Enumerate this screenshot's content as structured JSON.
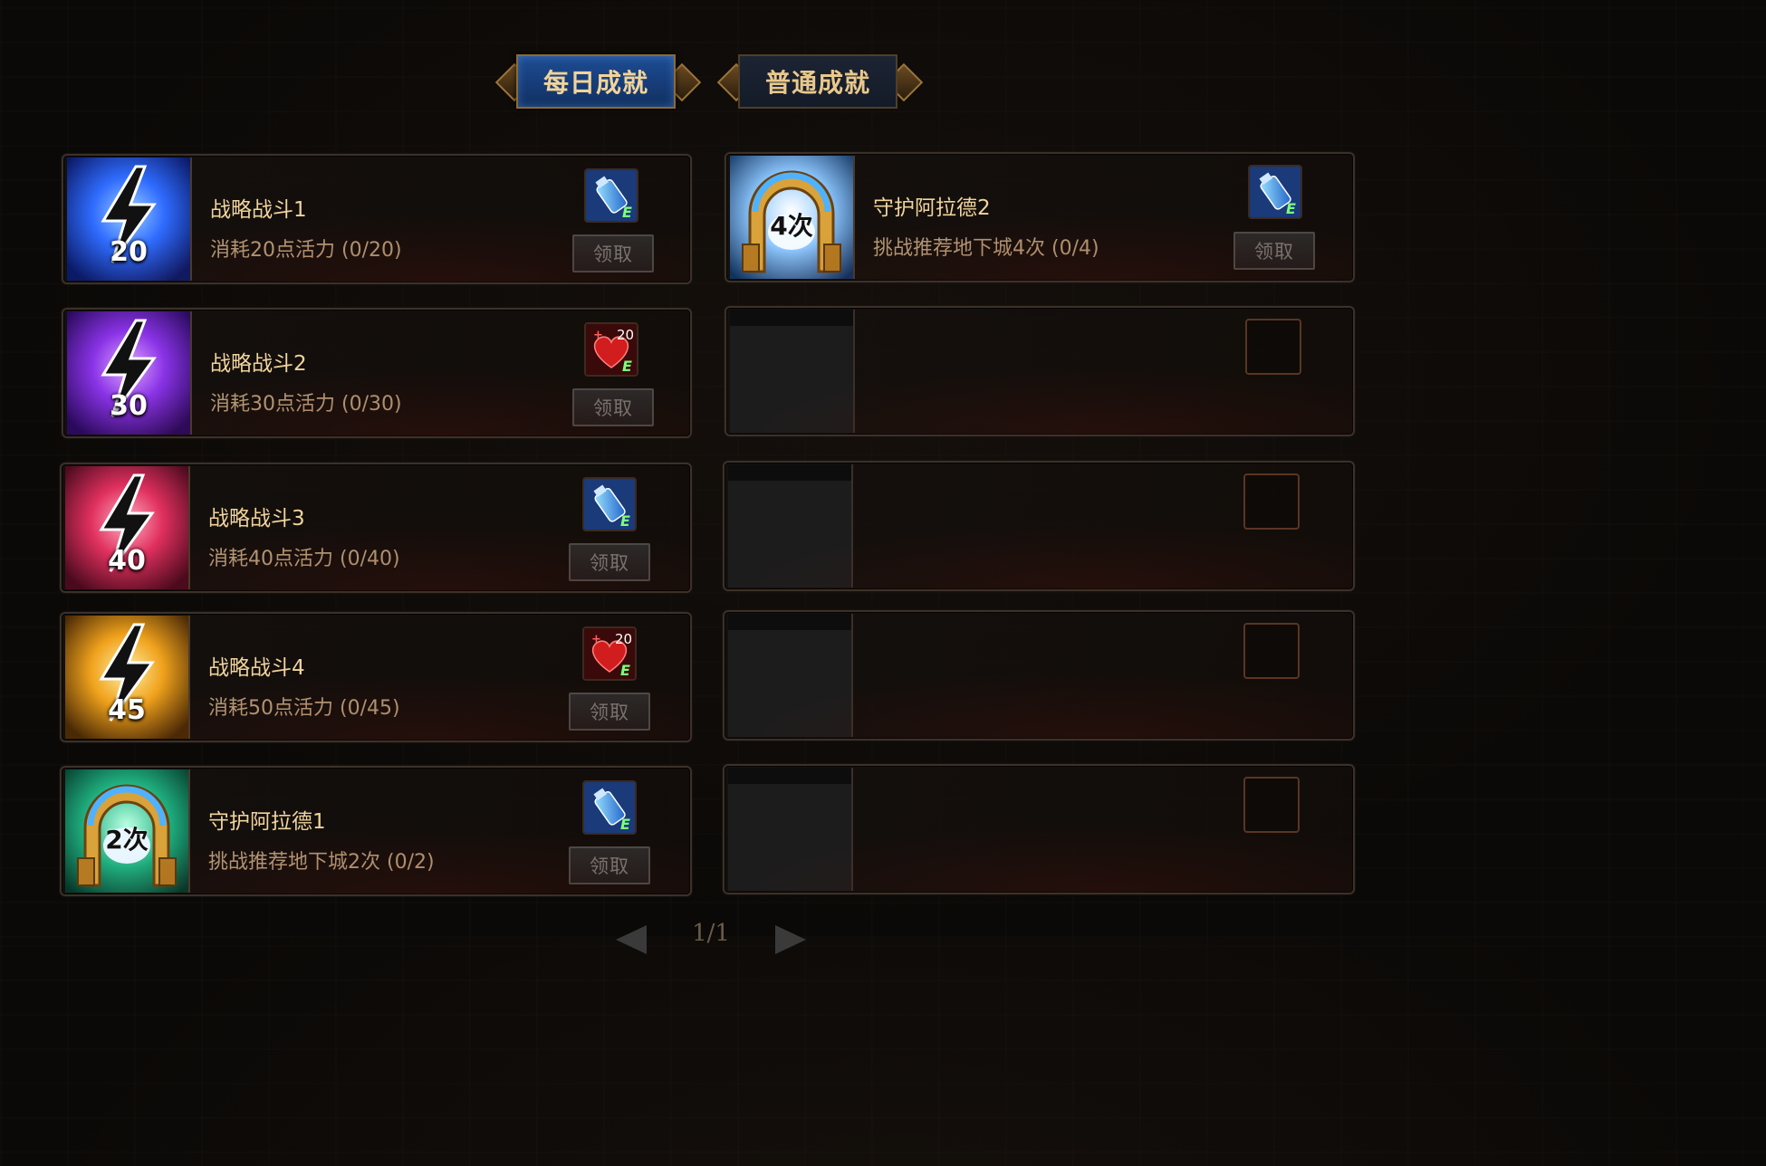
{
  "tabs": {
    "daily": "每日成就",
    "normal": "普通成就"
  },
  "claim_label": "领取",
  "left": [
    {
      "title": "战略战斗1",
      "desc": "消耗20点活力 (0/20)",
      "icon_value": "20",
      "icon": "lightning-icon",
      "icon_color": "#2f6cff",
      "reward": "vitality-potion-icon"
    },
    {
      "title": "战略战斗2",
      "desc": "消耗30点活力 (0/30)",
      "icon_value": "30",
      "icon": "lightning-icon",
      "icon_color": "#9a3cff",
      "reward": "heart-potion-icon",
      "reward_count": "20"
    },
    {
      "title": "战略战斗3",
      "desc": "消耗40点活力 (0/40)",
      "icon_value": "40",
      "icon": "lightning-icon",
      "icon_color": "#ff3a6e",
      "reward": "vitality-potion-icon"
    },
    {
      "title": "战略战斗4",
      "desc": "消耗50点活力 (0/45)",
      "icon_value": "45",
      "icon": "lightning-icon",
      "icon_color": "#ffb12a",
      "reward": "heart-potion-icon",
      "reward_count": "20"
    },
    {
      "title": "守护阿拉德1",
      "desc": "挑战推荐地下城2次 (0/2)",
      "icon_value": "2次",
      "icon": "dungeon-gate-icon",
      "icon_color": "#1fae7e",
      "reward": "vitality-potion-icon"
    }
  ],
  "right": [
    {
      "title": "守护阿拉德2",
      "desc": "挑战推荐地下城4次 (0/4)",
      "icon_value": "4次",
      "icon": "dungeon-gate-icon",
      "icon_color": "#3f8fe0",
      "reward": "vitality-potion-icon"
    }
  ],
  "pagination": {
    "text": "1/1"
  }
}
